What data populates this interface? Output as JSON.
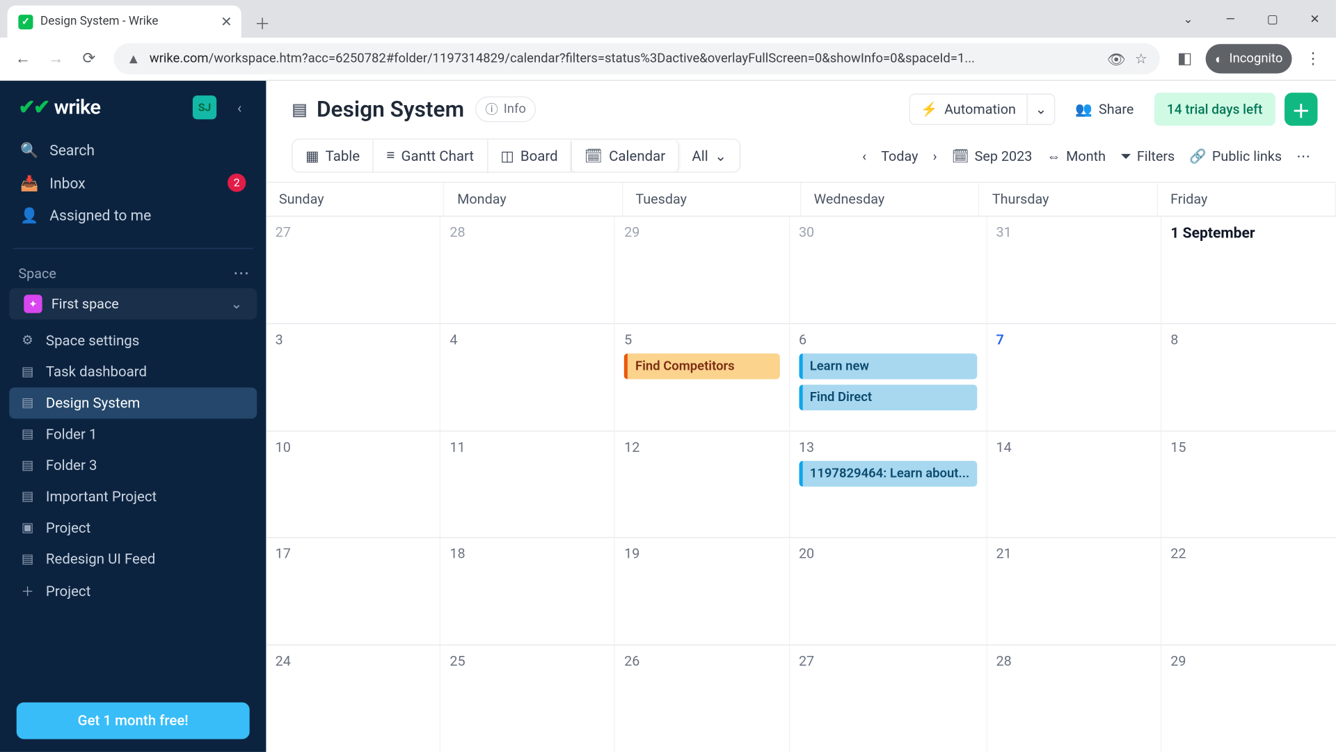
{
  "browser": {
    "tabTitle": "Design System - Wrike",
    "url_host": "wrike.com",
    "url_path": "/workspace.htm?acc=6250782#folder/1197314829/calendar?filters=status%3Dactive&overlayFullScreen=0&showInfo=0&spaceId=1...",
    "incognito": "Incognito"
  },
  "sidebar": {
    "brand": "wrike",
    "avatar": "SJ",
    "nav": [
      {
        "icon": "search",
        "label": "Search"
      },
      {
        "icon": "inbox",
        "label": "Inbox",
        "badge": "2"
      },
      {
        "icon": "assigned",
        "label": "Assigned to me"
      }
    ],
    "spaceHeader": "Space",
    "space": "First space",
    "tree": [
      {
        "icon": "gear",
        "label": "Space settings"
      },
      {
        "icon": "folder",
        "label": "Task dashboard"
      },
      {
        "icon": "folder",
        "label": "Design System",
        "sel": true
      },
      {
        "icon": "folder",
        "label": "Folder 1"
      },
      {
        "icon": "folder",
        "label": "Folder 3"
      },
      {
        "icon": "folder",
        "label": "Important Project"
      },
      {
        "icon": "proj",
        "label": "Project"
      },
      {
        "icon": "folder",
        "label": "Redesign UI Feed"
      },
      {
        "icon": "plus",
        "label": "Project"
      }
    ],
    "promo": "Get 1 month free!"
  },
  "header": {
    "title": "Design System",
    "info": "Info",
    "automation": "Automation",
    "share": "Share",
    "trial": "14 trial days left"
  },
  "views": {
    "tabs": [
      {
        "icon": "table",
        "label": "Table"
      },
      {
        "icon": "gantt",
        "label": "Gantt Chart"
      },
      {
        "icon": "board",
        "label": "Board"
      },
      {
        "icon": "cal",
        "label": "Calendar",
        "active": true
      },
      {
        "icon": "all",
        "label": "All",
        "chev": true
      }
    ],
    "nav": {
      "today": "Today",
      "period": "Sep 2023",
      "range": "Month",
      "filters": "Filters",
      "links": "Public links"
    }
  },
  "calendar": {
    "days": [
      "Sunday",
      "Monday",
      "Tuesday",
      "Wednesday",
      "Thursday",
      "Friday"
    ],
    "cells": [
      {
        "n": "27",
        "faded": true
      },
      {
        "n": "28",
        "faded": true
      },
      {
        "n": "29",
        "faded": true
      },
      {
        "n": "30",
        "faded": true
      },
      {
        "n": "31",
        "faded": true
      },
      {
        "n": "1 September",
        "bold": true
      },
      {
        "n": "3"
      },
      {
        "n": "4"
      },
      {
        "n": "5",
        "events": [
          {
            "c": "orange",
            "t": "Find Competitors"
          }
        ]
      },
      {
        "n": "6",
        "events": [
          {
            "c": "blue",
            "t": "Learn new"
          },
          {
            "c": "blue",
            "t": "Find Direct"
          }
        ]
      },
      {
        "n": "7",
        "today": true
      },
      {
        "n": "8"
      },
      {
        "n": "10"
      },
      {
        "n": "11"
      },
      {
        "n": "12"
      },
      {
        "n": "13",
        "events": [
          {
            "c": "blue",
            "t": "1197829464: Learn about..."
          }
        ]
      },
      {
        "n": "14"
      },
      {
        "n": "15"
      },
      {
        "n": "17"
      },
      {
        "n": "18"
      },
      {
        "n": "19"
      },
      {
        "n": "20"
      },
      {
        "n": "21"
      },
      {
        "n": "22"
      },
      {
        "n": "24"
      },
      {
        "n": "25"
      },
      {
        "n": "26"
      },
      {
        "n": "27"
      },
      {
        "n": "28"
      },
      {
        "n": "29"
      }
    ]
  }
}
